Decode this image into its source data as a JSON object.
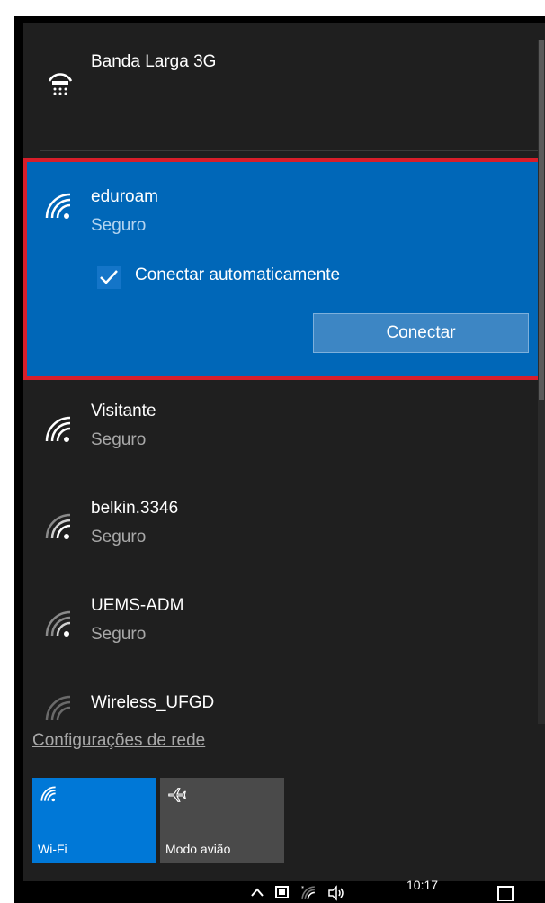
{
  "networks": [
    {
      "name": "Banda Larga 3G",
      "status": "",
      "icon": "cellular-modem-icon"
    },
    {
      "name": "eduroam",
      "status": "Seguro",
      "icon": "wifi-secure-icon",
      "selected": true
    },
    {
      "name": "Visitante",
      "status": "Seguro",
      "icon": "wifi-secure-icon"
    },
    {
      "name": "belkin.3346",
      "status": "Seguro",
      "icon": "wifi-secure-icon"
    },
    {
      "name": "UEMS-ADM",
      "status": "Seguro",
      "icon": "wifi-secure-icon"
    },
    {
      "name": "Wireless_UFGD",
      "status": "",
      "icon": "wifi-icon"
    }
  ],
  "selected": {
    "auto_connect_label": "Conectar automaticamente",
    "auto_connect_checked": true,
    "connect_button": "Conectar"
  },
  "settings_link": "Configurações de rede",
  "quick_actions": [
    {
      "label": "Wi-Fi",
      "active": true,
      "icon": "wifi-icon"
    },
    {
      "label": "Modo avião",
      "active": false,
      "icon": "airplane-icon"
    }
  ],
  "taskbar": {
    "time": "10:17"
  },
  "colors": {
    "accent": "#0067b8",
    "highlight_border": "#d81e2a",
    "panel": "#1f1f1f"
  }
}
